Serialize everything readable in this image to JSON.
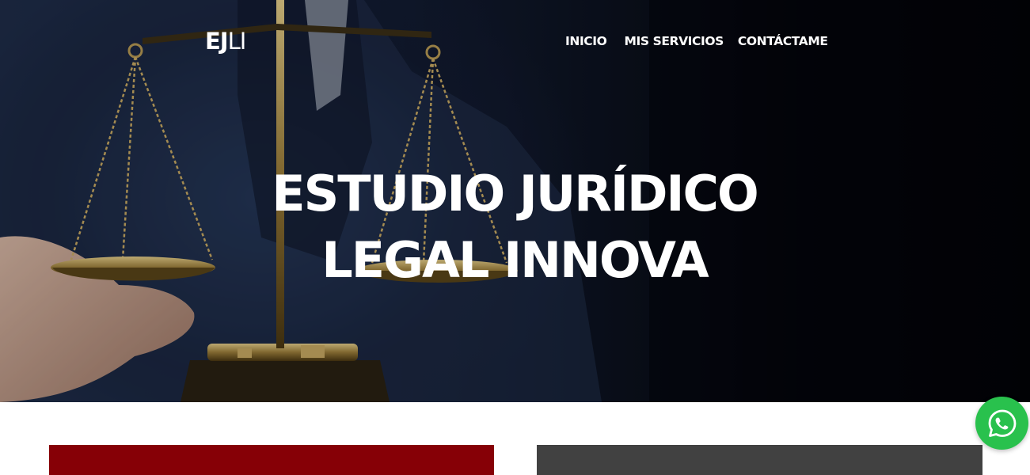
{
  "header": {
    "logo_bold": "EJ",
    "logo_thin": "LI",
    "nav": [
      {
        "label": "INICIO"
      },
      {
        "label": "MIS SERVICIOS"
      },
      {
        "label": "CONTÁCTAME"
      }
    ]
  },
  "hero": {
    "title_line1": "ESTUDIO JURÍDICO",
    "title_line2": "LEGAL INNOVA"
  },
  "colors": {
    "card_left": "#860006",
    "card_right": "#414141",
    "whatsapp": "#29c14d",
    "text": "#ffffff"
  },
  "icons": {
    "whatsapp": "whatsapp-icon"
  }
}
